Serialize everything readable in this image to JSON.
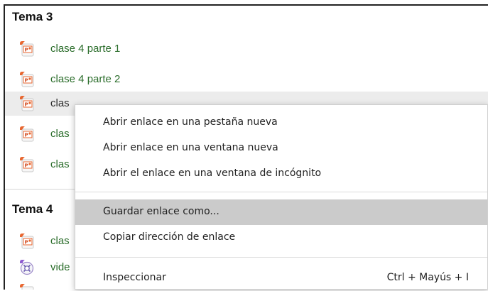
{
  "sections": [
    {
      "title": "Tema 3",
      "items": [
        {
          "label": "clase 4 parte 1",
          "icon": "powerpoint-icon"
        },
        {
          "label": "clase 4 parte 2",
          "icon": "powerpoint-icon"
        },
        {
          "label": "clas",
          "icon": "powerpoint-icon"
        },
        {
          "label": "clas",
          "icon": "powerpoint-icon"
        },
        {
          "label": "clas",
          "icon": "powerpoint-icon"
        }
      ]
    },
    {
      "title": "Tema 4",
      "items": [
        {
          "label": "clas",
          "icon": "powerpoint-icon"
        },
        {
          "label": "vide",
          "icon": "video-icon"
        },
        {
          "label": "",
          "icon": "powerpoint-icon"
        }
      ]
    }
  ],
  "context_menu": {
    "items": [
      {
        "label": "Abrir enlace en una pestaña nueva"
      },
      {
        "label": "Abrir enlace en una ventana nueva"
      },
      {
        "label": "Abrir el enlace en una ventana de incógnito"
      },
      {
        "label": "Guardar enlace como..."
      },
      {
        "label": "Copiar dirección de enlace"
      },
      {
        "label": "Inspeccionar",
        "shortcut": "Ctrl + Mayús + I"
      }
    ],
    "highlighted_index": 3
  },
  "colors": {
    "link": "#2c6e2c",
    "menu_highlight": "#cbcbcb",
    "powerpoint_orange": "#e8662f"
  }
}
